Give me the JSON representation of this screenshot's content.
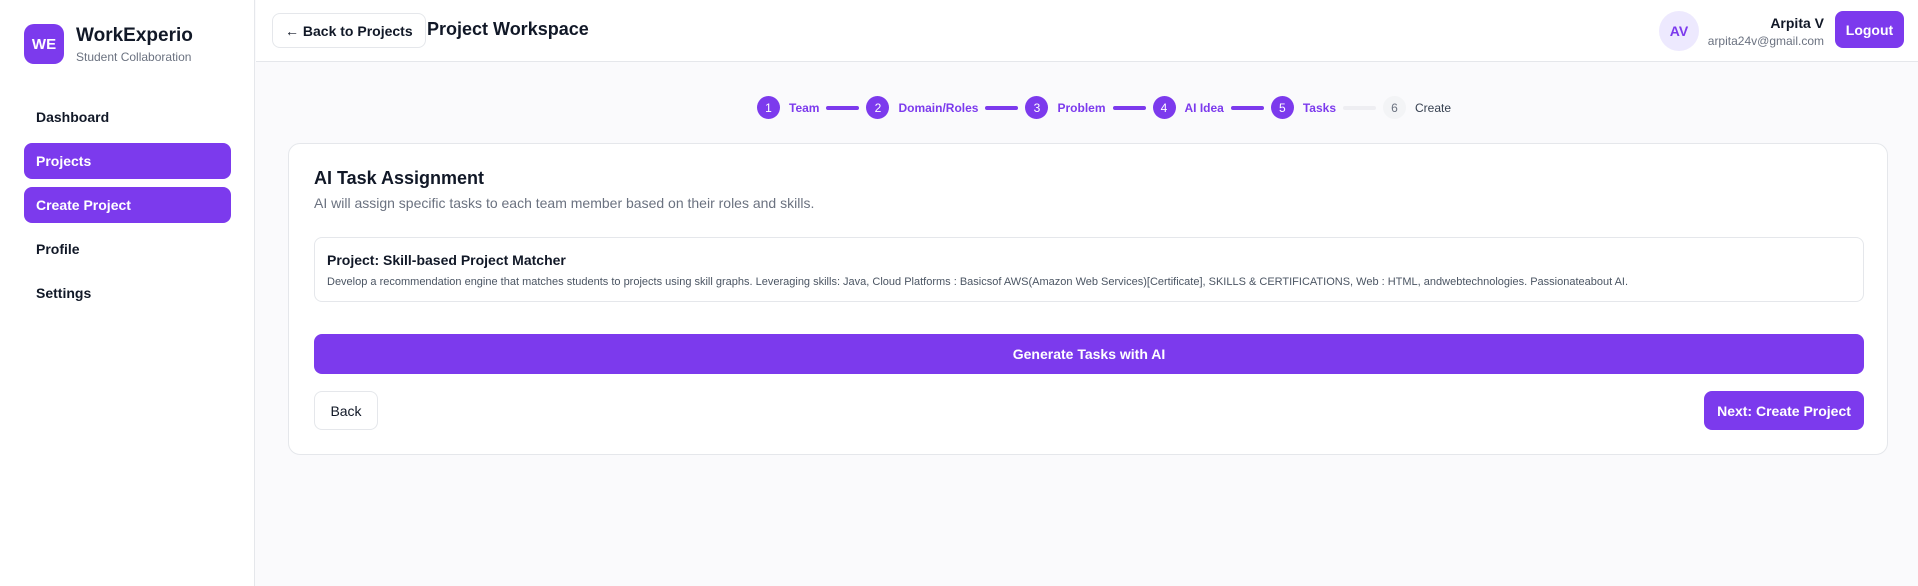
{
  "brand": {
    "logo": "WE",
    "name": "WorkExperio",
    "subtitle": "Student Collaboration"
  },
  "sidebar": {
    "items": [
      {
        "label": "Dashboard",
        "active": false
      },
      {
        "label": "Projects",
        "active": true
      },
      {
        "label": "Create Project",
        "active": true
      },
      {
        "label": "Profile",
        "active": false
      },
      {
        "label": "Settings",
        "active": false
      }
    ]
  },
  "header": {
    "back_label": "← Back to Projects",
    "title": "Project Workspace",
    "avatar_initials": "AV",
    "user_name": "Arpita V",
    "user_email": "arpita24v@gmail.com",
    "logout_label": "Logout"
  },
  "stepper": {
    "steps": [
      {
        "num": "1",
        "label": "Team",
        "done": true
      },
      {
        "num": "2",
        "label": "Domain/Roles",
        "done": true
      },
      {
        "num": "3",
        "label": "Problem",
        "done": true
      },
      {
        "num": "4",
        "label": "AI Idea",
        "done": true
      },
      {
        "num": "5",
        "label": "Tasks",
        "done": true
      },
      {
        "num": "6",
        "label": "Create",
        "done": false
      }
    ]
  },
  "card": {
    "title": "AI Task Assignment",
    "description": "AI will assign specific tasks to each team member based on their roles and skills.",
    "project_name": "Project: Skill-based Project Matcher",
    "project_description": "Develop a recommendation engine that matches students to projects using skill graphs. Leveraging skills: Java, Cloud Platforms : Basicsof AWS(Amazon Web Services)[Certificate], SKILLS & CERTIFICATIONS, Web : HTML, andwebtechnologies. Passionateabout AI.",
    "generate_label": "Generate Tasks with AI",
    "back_label": "Back",
    "next_label": "Next: Create Project"
  },
  "colors": {
    "accent": "#7c3aed",
    "accent_light": "#ede9fe",
    "border": "#e5e7eb",
    "background": "#fafafc"
  }
}
